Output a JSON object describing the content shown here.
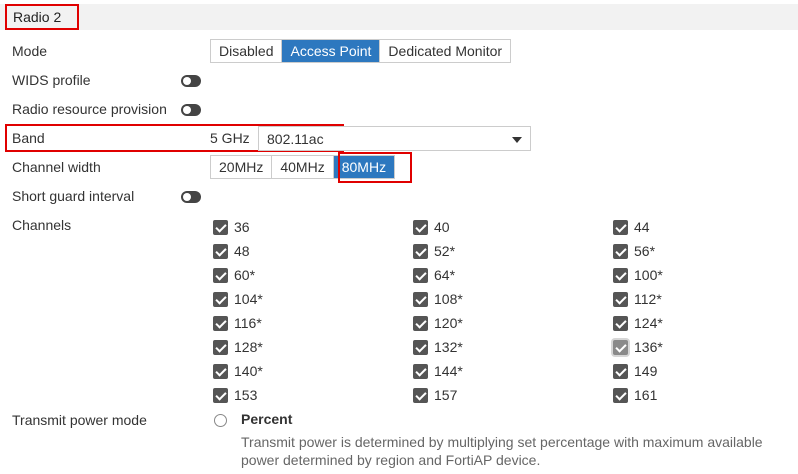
{
  "section": {
    "title": "Radio 2"
  },
  "mode": {
    "label": "Mode",
    "options": [
      "Disabled",
      "Access Point",
      "Dedicated Monitor"
    ],
    "selected": "Access Point"
  },
  "wids": {
    "label": "WIDS profile",
    "enabled": false
  },
  "rrp": {
    "label": "Radio resource provision",
    "enabled": false
  },
  "band": {
    "label": "Band",
    "prefix": "5 GHz",
    "value": "802.11ac"
  },
  "channel_width": {
    "label": "Channel width",
    "options": [
      "20MHz",
      "40MHz",
      "80MHz"
    ],
    "selected": "80MHz"
  },
  "sgi": {
    "label": "Short guard interval",
    "enabled": false
  },
  "channels": {
    "label": "Channels",
    "items": [
      "36",
      "40",
      "44",
      "48",
      "52*",
      "56*",
      "60*",
      "64*",
      "100*",
      "104*",
      "108*",
      "112*",
      "116*",
      "120*",
      "124*",
      "128*",
      "132*",
      "136*",
      "140*",
      "144*",
      "149",
      "153",
      "157",
      "161"
    ]
  },
  "transmit": {
    "label": "Transmit power mode",
    "option": "Percent",
    "description": "Transmit power is determined by multiplying set percentage with maximum available power determined by region and FortiAP device."
  },
  "colors": {
    "accent": "#2d78bf",
    "highlight": "#e00000",
    "checkbox": "#555555"
  }
}
